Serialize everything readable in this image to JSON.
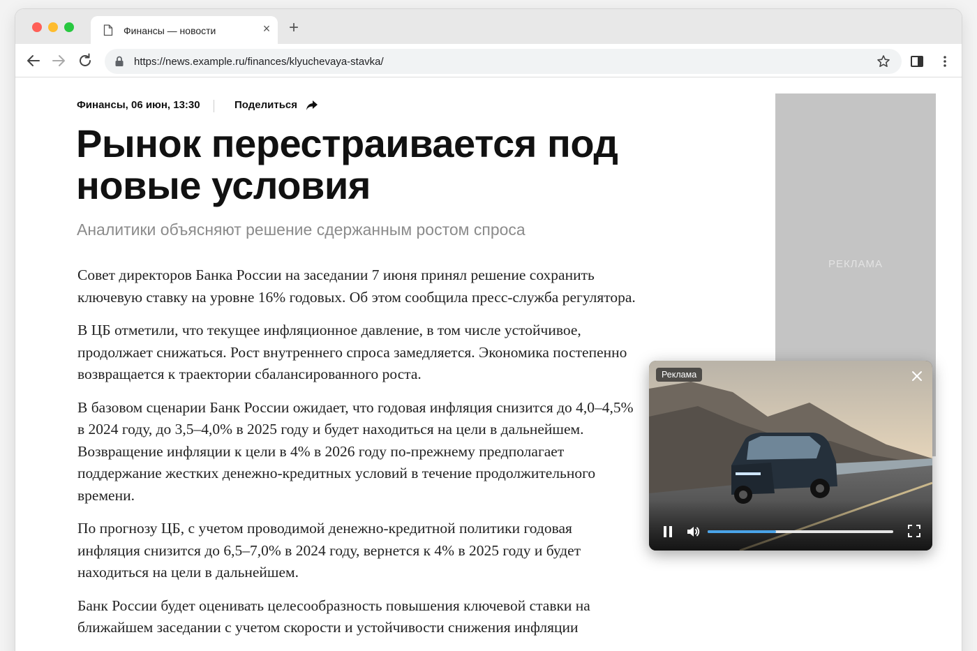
{
  "browser": {
    "tab_title": "Финансы — новости",
    "url": "https://news.example.ru/finances/klyuchevaya-stavka/"
  },
  "article": {
    "meta": "Финансы, 06 июн, 13:30",
    "share_label": "Поделиться",
    "headline": "Рынок перестраивается под новые условия",
    "subhead": "Аналитики объясняют решение сдержанным ростом спроса",
    "paragraphs": [
      "Совет директоров Банка России на заседании 7 июня принял решение сохранить ключевую ставку на уровне 16% годовых. Об этом сообщила пресс-служба регулятора.",
      "В ЦБ отметили, что текущее инфляционное давление, в том числе устойчивое, продолжает снижаться. Рост внутреннего спроса замедляется. Экономика постепенно возвращается к траектории сбалансированного роста.",
      "В базовом сценарии Банк России ожидает, что годовая инфляция снизится до 4,0–4,5% в 2024 году, до 3,5–4,0% в 2025 году и будет находиться на цели в дальнейшем. Возвращение инфляции к цели в 4% в 2026 году по-прежнему предполагает поддержание жестких денежно-кредитных условий в течение продолжительного времени.",
      "По прогнозу ЦБ, с учетом проводимой денежно-кредитной политики годовая инфляция снизится до 6,5–7,0% в 2024 году, вернется к 4% в 2025 году и будет находиться на цели в дальнейшем.",
      "Банк России будет оценивать целесообразность повышения ключевой ставки на ближайшем заседании с учетом скорости и устойчивости снижения инфляции"
    ]
  },
  "sidebar_ad": {
    "label": "РЕКЛАМА"
  },
  "video_ad": {
    "badge": "Реклама",
    "progress": 0.37
  },
  "colors": {
    "accent": "#4aa3e8",
    "ad_placeholder": "#c4c4c4"
  }
}
